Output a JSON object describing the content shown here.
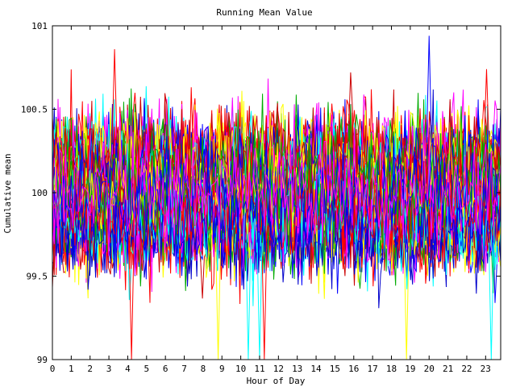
{
  "chart_data": {
    "type": "line",
    "title": "Running Mean Value",
    "xlabel": "Hour of Day",
    "ylabel": "Cumulative mean",
    "xlim": [
      0,
      23.8
    ],
    "ylim": [
      99,
      101
    ],
    "x_ticks": [
      "0",
      "1",
      "2",
      "3",
      "4",
      "5",
      "6",
      "7",
      "8",
      "9",
      "10",
      "11",
      "12",
      "13",
      "14",
      "15",
      "16",
      "17",
      "18",
      "19",
      "20",
      "21",
      "22",
      "23"
    ],
    "y_ticks": [
      "99",
      "99.5",
      "100",
      "100.5",
      "101"
    ],
    "grid": false,
    "legend": "none",
    "series_count": 140,
    "points_per_series": 240,
    "center": 100,
    "typical_spread": 0.3,
    "series_colors": [
      "#ff0000",
      "#00aa00",
      "#0000ff",
      "#ff00ff",
      "#00ffff",
      "#ffff00",
      "#0000cc",
      "#cc0000"
    ],
    "notable_spikes": [
      {
        "hour": 4.2,
        "value": 99.0,
        "color": "#ff0000"
      },
      {
        "hour": 11.25,
        "value": 99.0,
        "color": "#ff0000"
      },
      {
        "hour": 10.4,
        "value": 99.0,
        "color": "#00ffff"
      },
      {
        "hour": 11.0,
        "value": 99.0,
        "color": "#00ffff"
      },
      {
        "hour": 23.3,
        "value": 99.0,
        "color": "#00ffff"
      },
      {
        "hour": 8.8,
        "value": 99.0,
        "color": "#ffff00"
      },
      {
        "hour": 18.8,
        "value": 99.0,
        "color": "#ffff00"
      },
      {
        "hour": 20.0,
        "value": 100.94,
        "color": "#0000ff"
      },
      {
        "hour": 3.3,
        "value": 100.86,
        "color": "#ff0000"
      },
      {
        "hour": 23.05,
        "value": 100.74,
        "color": "#ff0000"
      }
    ]
  }
}
